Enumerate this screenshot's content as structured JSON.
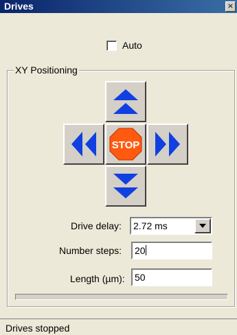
{
  "window": {
    "title": "Drives",
    "close_glyph": "×"
  },
  "auto": {
    "label": "Auto",
    "checked": false
  },
  "group": {
    "label": "XY Positioning",
    "buttons": {
      "up": {
        "icon": "double-arrow-up-icon"
      },
      "left": {
        "icon": "double-arrow-left-icon"
      },
      "stop": {
        "icon": "stop-sign-icon",
        "text": "STOP"
      },
      "right": {
        "icon": "double-arrow-right-icon"
      },
      "down": {
        "icon": "double-arrow-down-icon"
      }
    }
  },
  "fields": {
    "drive_delay": {
      "label": "Drive delay:",
      "value": "2.72 ms"
    },
    "number_steps": {
      "label": "Number steps:",
      "value": "20"
    },
    "length": {
      "label": "Length (µm):",
      "value": "50"
    }
  },
  "status": {
    "text": "Drives stopped"
  },
  "colors": {
    "arrow": "#1040e0",
    "stop": "#ff5a10",
    "titlebar": "#0a246a"
  }
}
